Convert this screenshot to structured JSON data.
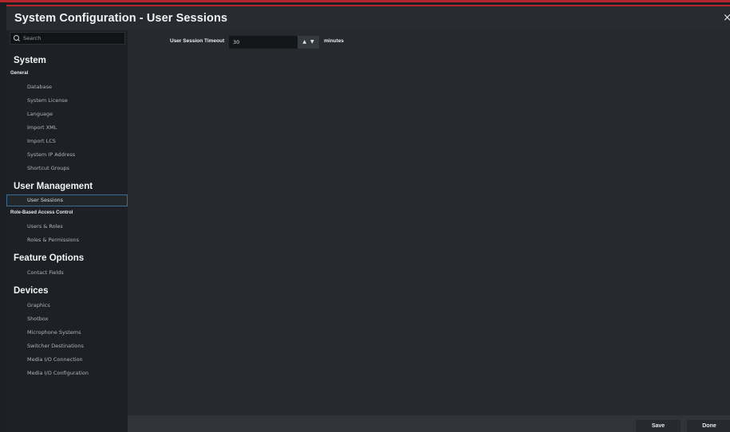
{
  "window": {
    "title": "System Configuration - User Sessions",
    "close_glyph": "×"
  },
  "search": {
    "placeholder": "Search",
    "icon": "search-icon"
  },
  "sidebar": {
    "sections": [
      {
        "label": "System"
      },
      {
        "label": "User Management"
      },
      {
        "label": "Feature Options"
      },
      {
        "label": "Devices"
      }
    ],
    "subsections": [
      {
        "label": "General"
      },
      {
        "label": "Role-Based Access Control"
      }
    ],
    "items": [
      {
        "label": "Database"
      },
      {
        "label": "System License"
      },
      {
        "label": "Language"
      },
      {
        "label": "Import XML"
      },
      {
        "label": "Import LCS"
      },
      {
        "label": "System IP Address"
      },
      {
        "label": "Shortcut Groups"
      },
      {
        "label": "User Sessions",
        "active": true
      },
      {
        "label": "Users & Roles"
      },
      {
        "label": "Roles & Permissions"
      },
      {
        "label": "Contact Fields"
      },
      {
        "label": "Graphics"
      },
      {
        "label": "Shotbox"
      },
      {
        "label": "Microphone Systems"
      },
      {
        "label": "Switcher Destinations"
      },
      {
        "label": "Media I/O Connection"
      },
      {
        "label": "Media I/O Configuration"
      }
    ]
  },
  "form": {
    "timeout_label": "User Session Timeout",
    "timeout_value": "30",
    "units": "minutes",
    "up_glyph": "▲",
    "down_glyph": "▼"
  },
  "footer": {
    "save_label": "Save",
    "done_label": "Done"
  },
  "colors": {
    "accent": "#b3242b",
    "selection_border": "#3e6b8f",
    "background": "#1b1e22"
  }
}
